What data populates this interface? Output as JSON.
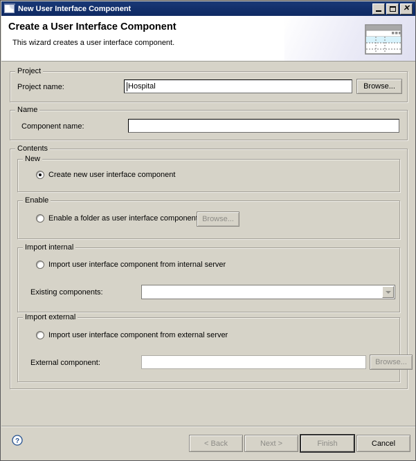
{
  "window": {
    "title": "New User Interface Component",
    "icon": "wizard-window-icon",
    "controls": {
      "minimize": "minimize-icon",
      "maximize": "maximize-icon",
      "close": "close-icon"
    }
  },
  "banner": {
    "title": "Create a User Interface Component",
    "subtitle": "This wizard creates a user interface component.",
    "icon": "ui-component-banner-icon"
  },
  "project": {
    "legend": "Project",
    "name_label": "Project name:",
    "name_value": "Hospital",
    "name_placeholder": "",
    "browse_label": "Browse..."
  },
  "name": {
    "legend": "Name",
    "component_label": "Component name:",
    "component_value": "",
    "component_placeholder": ""
  },
  "contents": {
    "legend": "Contents",
    "new": {
      "legend": "New",
      "radio_label": "Create new user interface component",
      "selected": true
    },
    "enable": {
      "legend": "Enable",
      "radio_label": "Enable a folder as user interface component",
      "selected": false,
      "browse_label": "Browse..."
    },
    "import_internal": {
      "legend": "Import internal",
      "radio_label": "Import user interface component from internal server",
      "selected": false,
      "existing_label": "Existing components:",
      "existing_value": "",
      "dropdown_icon": "chevron-down-icon"
    },
    "import_external": {
      "legend": "Import external",
      "radio_label": "Import user interface component from external server",
      "selected": false,
      "external_label": "External component:",
      "external_value": "",
      "browse_label": "Browse..."
    }
  },
  "footer": {
    "help_icon": "help-question-icon",
    "back_label": "< Back",
    "next_label": "Next >",
    "finish_label": "Finish",
    "cancel_label": "Cancel"
  },
  "colors": {
    "titlebar": "#13306c",
    "dialog_bg": "#d6d3c8",
    "banner_bg": "#ffffff",
    "help_blue": "#24508f"
  }
}
